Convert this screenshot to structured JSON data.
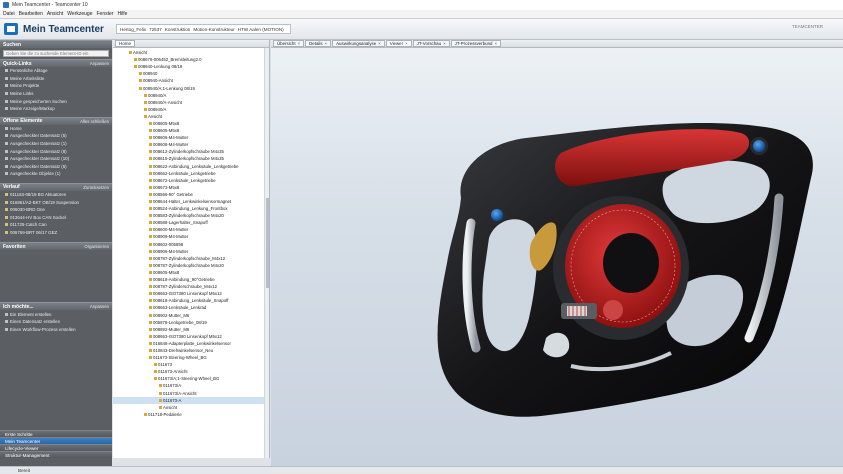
{
  "window": {
    "title": "Mein Teamcenter - Teamcenter 10"
  },
  "menu": [
    "Datei",
    "Bearbeiten",
    "Ansicht",
    "Werkzeuge",
    "Fenster",
    "Hilfe"
  ],
  "brand": {
    "name": "Mein Teamcenter",
    "product_label": "TEAMCENTER"
  },
  "breadcrumb": [
    "Hertog_Felix",
    "72537",
    "Konstruktion",
    "Motion-Konstrukteur",
    "HTW Aalen (MOTION)"
  ],
  "search": {
    "header": "Suchen",
    "placeholder": "Geben Sie die zu suchende Element-ID ein"
  },
  "quicklinks": {
    "header": "Quick-Links",
    "action": "Anpassen",
    "items": [
      "Persönliche Ablage",
      "Meine Arbeitsliste",
      "Meine Projekte",
      "Meine Links",
      "Meine gespeicherten Suchen",
      "Meine Anzeige/Markup"
    ]
  },
  "open_items": {
    "header": "Offene Elemente",
    "action": "Alles schließen",
    "items": [
      "Home",
      "Ausgecheckter Datensatz (5)",
      "Ausgecheckter Datensatz (1)",
      "Ausgecheckter Datensatz (8)",
      "Ausgecheckter Datensatz (10)",
      "Ausgecheckter Datensatz (6)",
      "Ausgecheckte Objekte (1)"
    ]
  },
  "history": {
    "header": "Verlauf",
    "action": "Zurücksetzen",
    "items": [
      "011163-08/19 BG Aktuatoren",
      "016861/A2-BKT OB/19 Suspension",
      "006030-BRD One",
      "013644-HV Box CAN Sockel",
      "011725-Catch Can",
      "006769-BRT 06/17 GEZ"
    ]
  },
  "favorites": {
    "header": "Favoriten",
    "action": "Organisieren"
  },
  "i_want": {
    "header": "Ich möchte...",
    "action": "Anpassen",
    "items": [
      "Ein Element erstellen",
      "Einen Datensatz erstellen",
      "Einen Workflow-Prozess erstellen"
    ]
  },
  "nav_buttons": [
    "Erste Schritte",
    "Mein Teamcenter",
    "Lifecycle-Viewer",
    "Struktur-Management"
  ],
  "tree": {
    "tab": "Home",
    "nodes": [
      "Ansicht",
      "008678-006452_Bremsleitung2.0",
      "008940-Lenkung 08/19",
      "008940",
      "008940-Ansicht",
      "008940/A;1-Lenkung 08/19",
      "008940/A",
      "008940/A-Ansicht",
      "008940/A",
      "Ansicht",
      "008605-M5x8",
      "008605-M5x8",
      "008606-M4-Mutter",
      "008608-M4-Mutter",
      "008612-Zylinderkopfschraube M4x35",
      "008615-Zylinderkopfschraube M4x35",
      "008622-Anbindung_Lenksäule_Lenkgetriebe",
      "008662-Lenksäule_Lenkgetriebe",
      "008672-Lenksäule_Lenkgetriebe",
      "008673-M5x8",
      "008566-90° Getriebe",
      "008644-Halter_Lenkwinkelsensormagnet",
      "008524-Anbindung_Lenkung_Frontbox",
      "008583-Zylinderkopfschraube M4x20",
      "008588-Lagerhalter_Snapoff",
      "008600-M4-Mutter",
      "008909-M4-Mutter",
      "008602-005898",
      "008906-M4-Mutter",
      "008787-Zylinderkopfschraube_M4x12",
      "008787-Zylinderkopfschraube M4x20",
      "008605-M5x8",
      "008618-Anbindung_90°Getriebe",
      "008787-Zylinderschraube_M4x12",
      "008663-ISO7380 Linsenkopf M5x12",
      "008618-Anbindung_Lenksäule_Snapoff",
      "008663-Lenksäule_Lenkrad",
      "008902-Mutter_M6",
      "005878-Lenkgetriebe_08/19",
      "008892-Mutter_M6",
      "008663-ISO7380 Linsenkopf M5x12",
      "016846-Adapterplatte_Lenkwinkelsensor",
      "010843-Drehwinkelsensor_Neu",
      "011673-Steering-Wheel_BG",
      "011673",
      "011673-Ansicht",
      "011673/A;1-Steering-Wheel_BG",
      "011673/A",
      "011673/A-Ansicht",
      "011673-A",
      "Ansicht",
      "011718-Pedalerie"
    ],
    "selected_index": 49
  },
  "viewer_tabs": [
    {
      "label": "Übersicht",
      "active": false
    },
    {
      "label": "Details",
      "active": false
    },
    {
      "label": "Auswirkungsanalyse",
      "active": false
    },
    {
      "label": "Viewer",
      "active": true
    },
    {
      "label": "JT-Vorschau",
      "active": false
    },
    {
      "label": "JT-Prozessverbund",
      "active": false
    }
  ],
  "status": {
    "text": "Bereit"
  },
  "colors": {
    "wheel_body": "#1a1a1c",
    "center_hub": "#c41e1e",
    "top_bar": "#b81c1c",
    "buttons": "#1e6fc4",
    "grips": "#b9c0c7",
    "viewer_bg": "#d7dfe8"
  }
}
